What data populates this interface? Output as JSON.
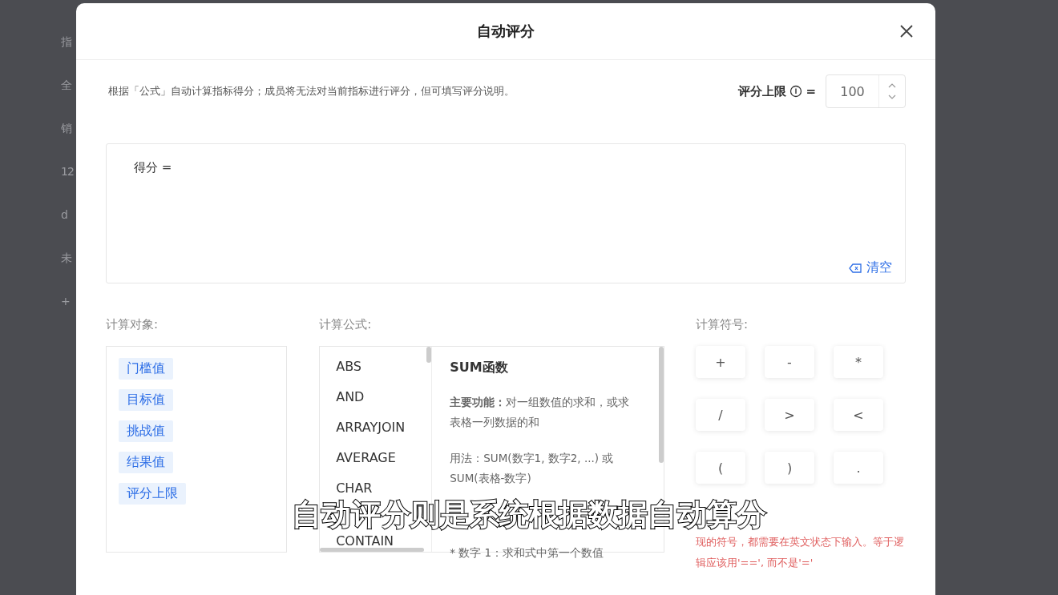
{
  "background_page": {
    "fragments": [
      "指",
      "全",
      "销",
      "12",
      "d",
      "未",
      "+"
    ]
  },
  "dialog": {
    "title": "自动评分",
    "description": "根据「公式」自动计算指标得分；成员将无法对当前指标进行评分，但可填写评分说明。",
    "score_limit": {
      "label": "评分上限",
      "suffix": "=",
      "value": "100"
    },
    "formula": {
      "label": "得分 =",
      "clear": "清空"
    },
    "objects": {
      "label": "计算对象:",
      "items": [
        "门槛值",
        "目标值",
        "挑战值",
        "结果值",
        "评分上限"
      ]
    },
    "functions": {
      "label": "计算公式:",
      "items": [
        "ABS",
        "AND",
        "ARRAYJOIN",
        "AVERAGE",
        "CHAR",
        "CONTAIN"
      ],
      "detail": {
        "title": "SUM函数",
        "lines": [
          "**主要功能：**对一组数值的求和，或求表格一列数据的和",
          "用法：SUM(数字1, 数字2, ...) 或SUM(表格-数字)",
          "* 数字 1：求和式中第一个数值"
        ]
      }
    },
    "symbols": {
      "label": "计算符号:",
      "items": [
        "+",
        "-",
        "*",
        "/",
        ">",
        "<",
        "(",
        ")",
        "."
      ],
      "note": "现的符号，都需要在英文状态下输入。等于逻辑应该用'==', 而不是'='"
    }
  },
  "subtitle": "自动评分则是系统根据数据自动算分"
}
